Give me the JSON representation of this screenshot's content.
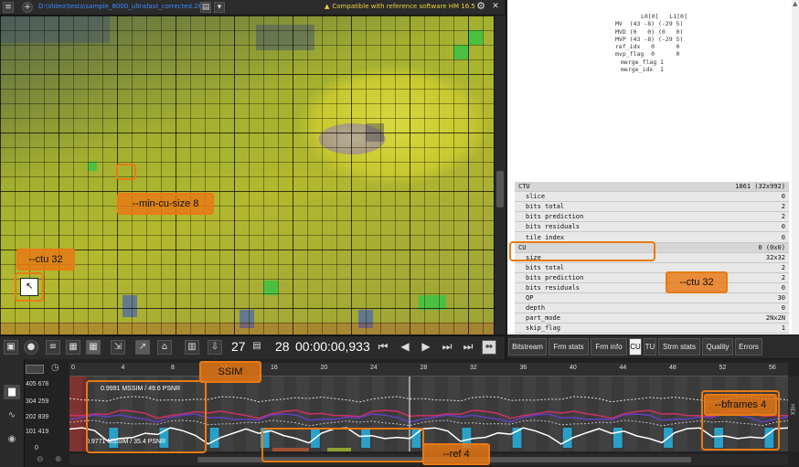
{
  "top_bar": {
    "file_path": "D:\\Video\\tests\\sample_8000_ultrafast_corrected.265",
    "compat_message": "Compatible with reference software HM 16.5"
  },
  "motion_info": {
    "header": "L0[0]   L1[0]",
    "lines": [
      "MV  (43 -8) (-29 5)",
      "MVD (0   0) (0   0)",
      "MVP (43 -8) (-29 5)",
      "ref_idx   0      0",
      "mvp_flag  0      0",
      "merge_flag 1",
      "merge_idx  1"
    ]
  },
  "cu_table": [
    {
      "name": "CTU",
      "value": "1861  (32x992)",
      "header": true
    },
    {
      "name": "slice",
      "value": "0"
    },
    {
      "name": "bits total",
      "value": "2"
    },
    {
      "name": "bits prediction",
      "value": "2"
    },
    {
      "name": "bits residuals",
      "value": "0"
    },
    {
      "name": "tile index",
      "value": "0"
    },
    {
      "name": "CU",
      "value": "0  (0x0)",
      "header": true
    },
    {
      "name": "size",
      "value": "32x32"
    },
    {
      "name": "bits total",
      "value": "2"
    },
    {
      "name": "bits prediction",
      "value": "2"
    },
    {
      "name": "bits residuals",
      "value": "0"
    },
    {
      "name": "QP",
      "value": "30"
    },
    {
      "name": "depth",
      "value": "0"
    },
    {
      "name": "part_mode",
      "value": "2Nx2N"
    },
    {
      "name": "skip_flag",
      "value": "1"
    }
  ],
  "toolbar": {
    "frame_current": "27",
    "frame_next": "28",
    "timecode": "00:00:00,933"
  },
  "tabs": [
    "Bitstream",
    "Frm stats",
    "Frm info",
    "CU",
    "TU",
    "Strm stats",
    "Quality",
    "Errors"
  ],
  "active_tab": "CU",
  "graph": {
    "y_labels": [
      "405 678",
      "304 259",
      "202 839",
      "101 419",
      "0"
    ],
    "ruler_ticks": [
      "0",
      "4",
      "8",
      "12",
      "16",
      "20",
      "24",
      "28",
      "32",
      "36",
      "40",
      "44",
      "48",
      "52",
      "56"
    ],
    "ssim_top_label": "0.9991 MSSIM / 49.6 PSNR",
    "ssim_bottom_label": "0.9771 MSSIM / 35.4 PSNR",
    "side_tab_label": "HEX"
  },
  "annotations": {
    "min_cu": "--min-cu-size  8",
    "ctu_left": "--ctu 32",
    "ctu_right": "--ctu 32",
    "ssim": "SSIM",
    "bframes": "--bframes  4",
    "ref": "--ref  4"
  },
  "colors": {
    "accent_orange": "#e87a14",
    "path_blue": "#3c8cff",
    "warning_yellow": "#f0d040"
  }
}
